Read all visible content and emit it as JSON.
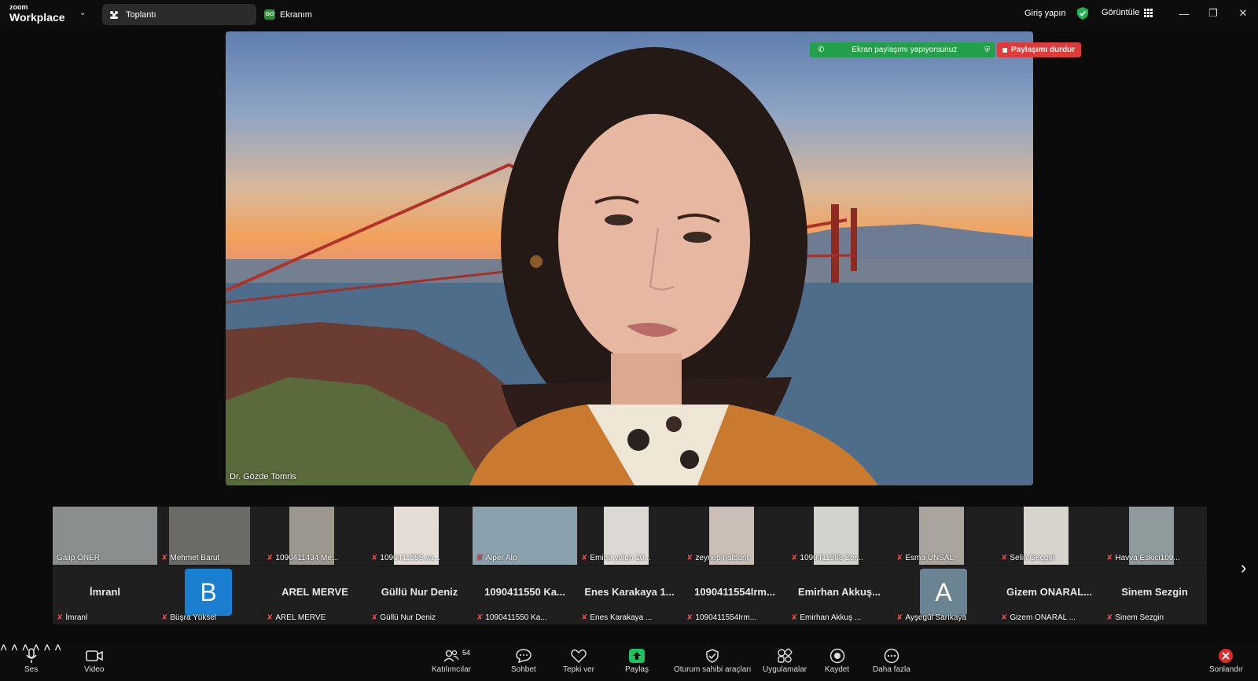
{
  "app": {
    "logo_small": "zoom",
    "logo_big": "Workplace",
    "meeting_tab": "Toplantı",
    "screen_tab": "Ekranım",
    "screen_badge": "GO",
    "signin": "Giriş yapın",
    "view": "Görüntüle"
  },
  "share": {
    "status": "Ekran paylaşımı yapıyorsunuz",
    "stop": "Paylaşımı durdur"
  },
  "main_video": {
    "speaker": "Dr. Gözde Tomris"
  },
  "gallery": {
    "row1": [
      {
        "name": "Galip ÖNER",
        "muted": false,
        "bg": "#8a8e8f"
      },
      {
        "name": "Mehmet Barut",
        "muted": true,
        "bg": "#6b6a67"
      },
      {
        "name": "1090411434 Me...",
        "muted": true,
        "bg": "#9c9890"
      },
      {
        "name": "1090411555 ya...",
        "muted": true,
        "bg": "#e3ddd6"
      },
      {
        "name": "Alper Alp",
        "muted": true,
        "bg": "#8ba2ae"
      },
      {
        "name": "Emine yolun 10...",
        "muted": true,
        "bg": "#dcd9d4"
      },
      {
        "name": "zeynep nalbant",
        "muted": true,
        "bg": "#c9bfb6"
      },
      {
        "name": "1090411588 Zer...",
        "muted": true,
        "bg": "#d4d2cd"
      },
      {
        "name": "Esma ÜNSAL",
        "muted": true,
        "bg": "#a9a59e"
      },
      {
        "name": "Selin Geçgel",
        "muted": true,
        "bg": "#d7d3cd"
      },
      {
        "name": "Havva Eskici109...",
        "muted": true,
        "bg": "#8e9a9c"
      }
    ],
    "row2": [
      {
        "big": "İmranl",
        "name": "İmranl"
      },
      {
        "big": "",
        "avatar": "B",
        "avatar_color": "#1a7fd1",
        "name": "Büşra Yüksel"
      },
      {
        "big": "AREL MERVE",
        "name": "AREL MERVE"
      },
      {
        "big": "Güllü Nur Deniz",
        "name": "Güllü Nur Deniz"
      },
      {
        "big": "1090411550 Ka...",
        "name": "1090411550 Ka..."
      },
      {
        "big": "Enes Karakaya 1...",
        "name": "Enes Karakaya ..."
      },
      {
        "big": "1090411554Irm...",
        "name": "1090411554Irm..."
      },
      {
        "big": "Emirhan Akkuş...",
        "name": "Emirhan Akkuş ..."
      },
      {
        "big": "",
        "avatar": "A",
        "avatar_color": "#6b8494",
        "name": "Ayşegül Sarıkaya"
      },
      {
        "big": "Gizem ONARAL...",
        "name": "Gizem ONARAL ..."
      },
      {
        "big": "Sinem Sezgin",
        "name": "Sinem Sezgin"
      }
    ]
  },
  "toolbar": {
    "audio": "Ses",
    "video": "Video",
    "participants": "Katılımcılar",
    "participant_count": "54",
    "chat": "Sohbet",
    "react": "Tepki ver",
    "share": "Paylaş",
    "host_tools": "Oturum sahibi araçları",
    "apps": "Uygulamalar",
    "record": "Kaydet",
    "more": "Daha fazla",
    "end": "Sonlandır"
  },
  "colors": {
    "share_green": "#23a04a",
    "stop_red": "#e03b3b",
    "share_icon_green": "#1fc15a"
  }
}
